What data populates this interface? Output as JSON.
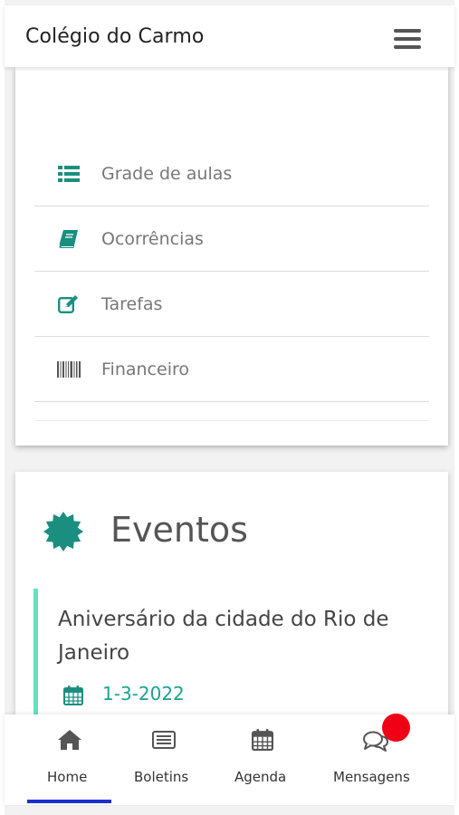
{
  "appbar": {
    "title": "Colégio do Carmo",
    "menu_icon": "hamburger-menu-icon"
  },
  "menu": {
    "items": [
      {
        "label": "Grade de aulas",
        "icon": "list-icon"
      },
      {
        "label": "Ocorrências",
        "icon": "book-icon"
      },
      {
        "label": "Tarefas",
        "icon": "edit-icon"
      },
      {
        "label": "Financeiro",
        "icon": "barcode-icon"
      }
    ]
  },
  "events": {
    "title": "Eventos",
    "icon": "certificate-badge-icon",
    "items": [
      {
        "name": "Aniversário da cidade do Rio de Janeiro",
        "date": "1-3-2022",
        "date_icon": "calendar-icon"
      }
    ]
  },
  "bottom_nav": {
    "items": [
      {
        "label": "Home",
        "icon": "home-icon",
        "active": true
      },
      {
        "label": "Boletins",
        "icon": "newspaper-icon",
        "active": false
      },
      {
        "label": "Agenda",
        "icon": "calendar-icon",
        "active": false
      },
      {
        "label": "Mensagens",
        "icon": "chat-icon",
        "active": false
      }
    ]
  },
  "colors": {
    "accent": "#1a8f7f",
    "accent_light": "#5ee3c0",
    "date_text": "#1aa390",
    "active_tab": "#1e2fcf",
    "notification": "#f00014"
  }
}
